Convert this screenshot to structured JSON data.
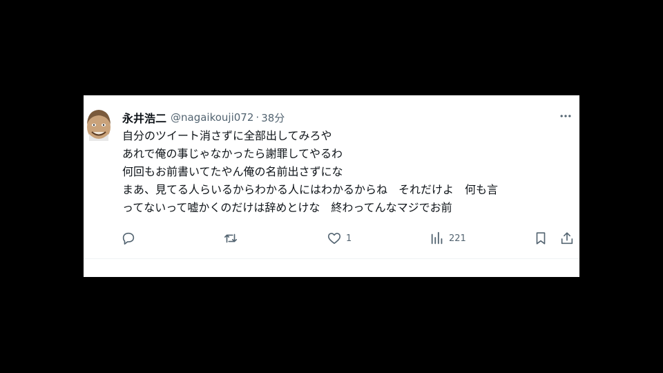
{
  "tweet": {
    "author_name": "永井浩二",
    "handle": "@nagaikouji072",
    "separator": "·",
    "time": "38分",
    "lines": [
      "自分のツイート消さずに全部出してみろや",
      "あれで俺の事じゃなかったら謝罪してやるわ",
      "何回もお前書いてたやん俺の名前出さずにな",
      "まあ、見てる人らいるからわかる人にはわかるからね　それだけよ　何も言",
      "ってないって嘘かくのだけは辞めとけな　終わってんなマジでお前"
    ]
  },
  "actions": {
    "reply_count": "",
    "retweet_count": "",
    "like_count": "1",
    "view_count": "221"
  },
  "icons": {
    "avatar": "avatar-illustration",
    "more": "more-icon",
    "reply": "reply-icon",
    "retweet": "retweet-icon",
    "like": "heart-icon",
    "views": "views-icon",
    "bookmark": "bookmark-icon",
    "share": "share-icon"
  },
  "colors": {
    "background": "#000000",
    "card": "#ffffff",
    "text": "#0f1419",
    "secondary": "#536471"
  }
}
